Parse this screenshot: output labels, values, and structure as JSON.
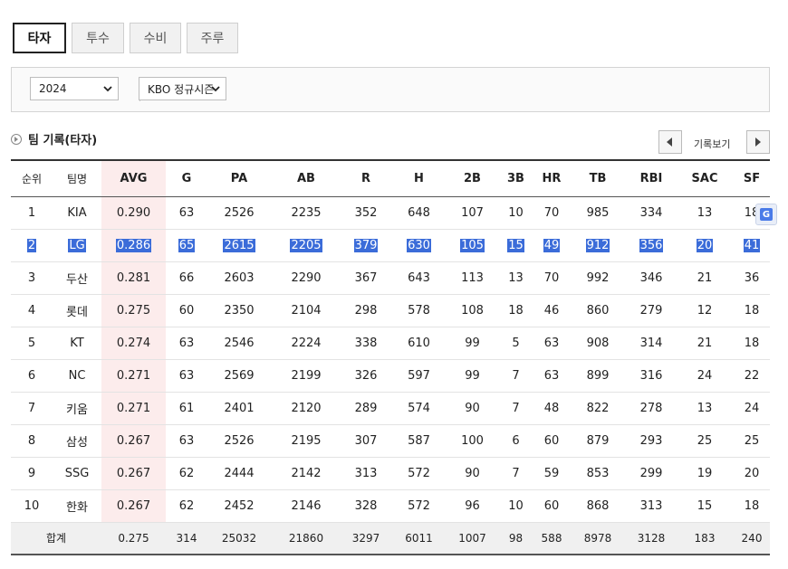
{
  "tabs": [
    {
      "label": "타자",
      "active": true
    },
    {
      "label": "투수",
      "active": false
    },
    {
      "label": "수비",
      "active": false
    },
    {
      "label": "주루",
      "active": false
    }
  ],
  "filters": {
    "year": "2024",
    "season": "KBO 정규시즌"
  },
  "section": {
    "title": "팀 기록(타자)",
    "pager_label": "기록보기"
  },
  "table": {
    "headers": [
      "순위",
      "팀명",
      "AVG",
      "G",
      "PA",
      "AB",
      "R",
      "H",
      "2B",
      "3B",
      "HR",
      "TB",
      "RBI",
      "SAC",
      "SF"
    ],
    "rows": [
      [
        "1",
        "KIA",
        "0.290",
        "63",
        "2526",
        "2235",
        "352",
        "648",
        "107",
        "10",
        "70",
        "985",
        "334",
        "13",
        "18"
      ],
      [
        "2",
        "LG",
        "0.286",
        "65",
        "2615",
        "2205",
        "379",
        "630",
        "105",
        "15",
        "49",
        "912",
        "356",
        "20",
        "41"
      ],
      [
        "3",
        "두산",
        "0.281",
        "66",
        "2603",
        "2290",
        "367",
        "643",
        "113",
        "13",
        "70",
        "992",
        "346",
        "21",
        "36"
      ],
      [
        "4",
        "롯데",
        "0.275",
        "60",
        "2350",
        "2104",
        "298",
        "578",
        "108",
        "18",
        "46",
        "860",
        "279",
        "12",
        "18"
      ],
      [
        "5",
        "KT",
        "0.274",
        "63",
        "2546",
        "2224",
        "338",
        "610",
        "99",
        "5",
        "63",
        "908",
        "314",
        "21",
        "18"
      ],
      [
        "6",
        "NC",
        "0.271",
        "63",
        "2569",
        "2199",
        "326",
        "597",
        "99",
        "7",
        "63",
        "899",
        "316",
        "24",
        "22"
      ],
      [
        "7",
        "키움",
        "0.271",
        "61",
        "2401",
        "2120",
        "289",
        "574",
        "90",
        "7",
        "48",
        "822",
        "278",
        "13",
        "24"
      ],
      [
        "8",
        "삼성",
        "0.267",
        "63",
        "2526",
        "2195",
        "307",
        "587",
        "100",
        "6",
        "60",
        "879",
        "293",
        "25",
        "25"
      ],
      [
        "9",
        "SSG",
        "0.267",
        "62",
        "2444",
        "2142",
        "313",
        "572",
        "90",
        "7",
        "59",
        "853",
        "299",
        "19",
        "20"
      ],
      [
        "10",
        "한화",
        "0.267",
        "62",
        "2452",
        "2146",
        "328",
        "572",
        "96",
        "10",
        "60",
        "868",
        "313",
        "15",
        "18"
      ]
    ],
    "selected_row": 1,
    "footer": [
      "합계",
      "0.275",
      "314",
      "25032",
      "21860",
      "3297",
      "6011",
      "1007",
      "98",
      "588",
      "8978",
      "3128",
      "183",
      "240"
    ]
  },
  "icons": {
    "section_icon": "circle-arrow-icon",
    "prev": "chevron-left-icon",
    "next": "chevron-right-icon",
    "translate": "google-translate-icon"
  },
  "colors": {
    "avg_column_bg": "#fcecec",
    "selection": "#3b6cd9"
  }
}
